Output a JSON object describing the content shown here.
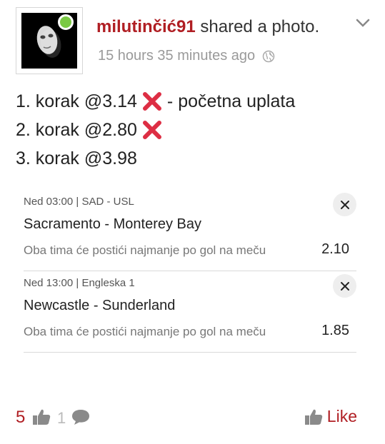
{
  "post": {
    "username": "milutinčić91",
    "action": " shared a photo.",
    "timestamp": "15 hours 35 minutes ago",
    "online": true
  },
  "message": {
    "lines": [
      {
        "text_a": "1. korak @3.14",
        "status": "lost",
        "text_b": "- početna uplata"
      },
      {
        "text_a": "2. korak @2.80",
        "status": "lost"
      },
      {
        "text_a": "3. korak @3.98"
      }
    ]
  },
  "ticket": {
    "bets": [
      {
        "meta": "Ned 03:00 | SAD - USL",
        "match": "Sacramento - Monterey Bay",
        "market": "Oba tima će postići najmanje po gol na meču",
        "odds": "2.10"
      },
      {
        "meta": "Ned 13:00 | Engleska 1",
        "match": "Newcastle - Sunderland",
        "market": "Oba tima će postići najmanje po gol na meču",
        "odds": "1.85"
      }
    ]
  },
  "footer": {
    "like_count": "5",
    "comment_count": "1",
    "like_label": "Like"
  },
  "icons": {
    "lost_mark": "cross-mark-icon",
    "remove": "close-icon",
    "like": "thumbs-up-icon",
    "comment": "speech-bubble-icon",
    "privacy": "globe-icon",
    "menu": "chevron-down-icon"
  },
  "colors": {
    "brand": "#b01e23",
    "online": "#7ac943",
    "lost": "#dd2e44",
    "muted": "#9a9a9a"
  }
}
